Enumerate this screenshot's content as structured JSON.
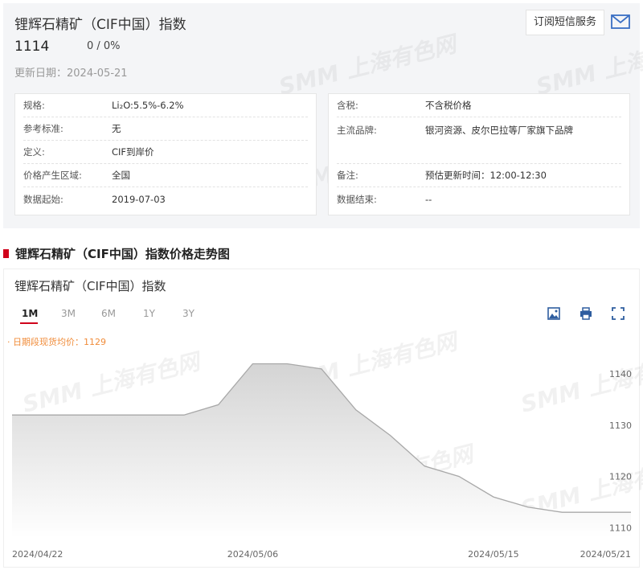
{
  "header": {
    "title": "锂辉石精矿（CIF中国）指数",
    "price": "1114",
    "change": "0  /  0%",
    "update_label": "更新日期：",
    "update_date": "2024-05-21",
    "subscribe_label": "订阅短信服务",
    "watermark": "SMM 上海有色网"
  },
  "specs_left": [
    {
      "key": "规格:",
      "value": "Li₂O:5.5%-6.2%"
    },
    {
      "key": "参考标准:",
      "value": "无"
    },
    {
      "key": "定义:",
      "value": "CIF到岸价"
    },
    {
      "key": "价格产生区域:",
      "value": "全国"
    },
    {
      "key": "数据起始:",
      "value": "2019-07-03"
    }
  ],
  "specs_right": [
    {
      "key": "含税:",
      "value": "不含税价格"
    },
    {
      "key": "主流品牌:",
      "value": "银河资源、皮尔巴拉等厂家旗下品牌"
    },
    {
      "key": "备注:",
      "value": "预估更新时间：12:00-12:30"
    },
    {
      "key": "数据结束:",
      "value": "--"
    }
  ],
  "section": {
    "title": "锂辉石精矿（CIF中国）指数价格走势图"
  },
  "chart_panel": {
    "title": "锂辉石精矿（CIF中国）指数",
    "tabs": [
      "1M",
      "3M",
      "6M",
      "1Y",
      "3Y"
    ],
    "active_tab": "1M",
    "avg_label": "· 日期段现货均价：1129"
  },
  "chart_data": {
    "type": "area",
    "x": [
      "2024-04-22",
      "2024-04-23",
      "2024-04-24",
      "2024-04-25",
      "2024-04-26",
      "2024-04-29",
      "2024-04-30",
      "2024-05-06",
      "2024-05-07",
      "2024-05-08",
      "2024-05-09",
      "2024-05-10",
      "2024-05-13",
      "2024-05-14",
      "2024-05-15",
      "2024-05-16",
      "2024-05-17",
      "2024-05-20",
      "2024-05-21"
    ],
    "values": [
      1132,
      1132,
      1132,
      1132,
      1132,
      1132,
      1134,
      1142,
      1142,
      1141,
      1133,
      1128,
      1122,
      1120,
      1116,
      1114,
      1113,
      1113,
      1113
    ],
    "x_tick_labels": [
      "2024/04/22",
      "2024/05/06",
      "2024/05/15",
      "2024/05/21"
    ],
    "x_tick_indices": [
      0,
      7,
      14,
      18
    ],
    "y_ticks": [
      1110,
      1120,
      1130,
      1140
    ],
    "ylim": [
      1108,
      1146
    ],
    "line_color": "#a8a8a8",
    "fill_top": "#d4d4d4",
    "fill_bottom": "#ffffff",
    "grid": false
  }
}
